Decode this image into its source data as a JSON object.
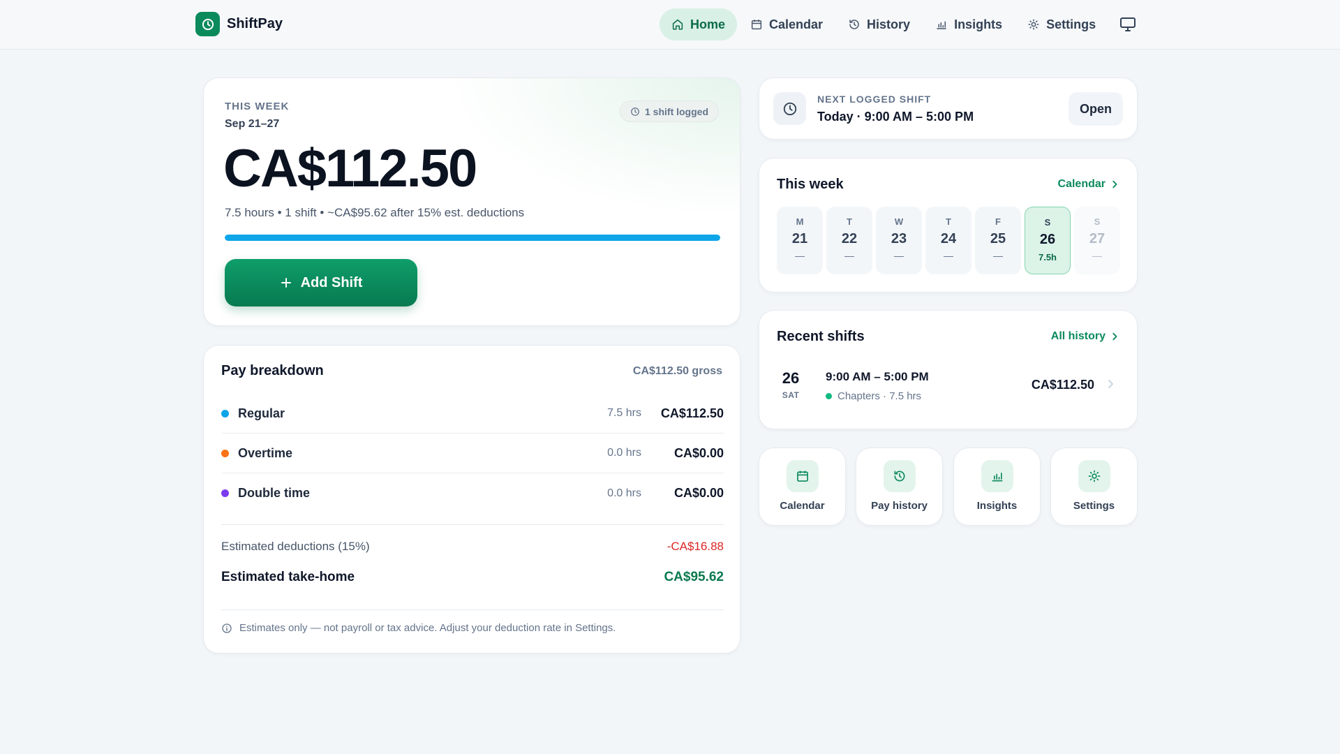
{
  "app": {
    "name": "ShiftPay"
  },
  "nav": {
    "items": [
      {
        "label": "Home",
        "icon": "home-icon",
        "active": true
      },
      {
        "label": "Calendar",
        "icon": "calendar-icon"
      },
      {
        "label": "History",
        "icon": "history-icon"
      },
      {
        "label": "Insights",
        "icon": "bar-chart-icon"
      },
      {
        "label": "Settings",
        "icon": "sun-gear-icon"
      }
    ],
    "display_icon": "monitor-icon"
  },
  "hero": {
    "eyebrow": "THIS WEEK",
    "range": "Sep 21–27",
    "badge": "1 shift logged",
    "amount": "CA$112.50",
    "subtitle": "7.5 hours • 1 shift • ~CA$95.62 after 15% est. deductions",
    "progress_percent": 100,
    "progress_color": "#0ea5e9",
    "add_button": "Add Shift"
  },
  "breakdown": {
    "title": "Pay breakdown",
    "gross": "CA$112.50 gross",
    "rows": [
      {
        "label": "Regular",
        "hours": "7.5 hrs",
        "amount": "CA$112.50",
        "color": "#0ea5e9"
      },
      {
        "label": "Overtime",
        "hours": "0.0 hrs",
        "amount": "CA$0.00",
        "color": "#f97316"
      },
      {
        "label": "Double time",
        "hours": "0.0 hrs",
        "amount": "CA$0.00",
        "color": "#7c3aed"
      }
    ],
    "deductions_label": "Estimated deductions (15%)",
    "deductions_value": "-CA$16.88",
    "takehome_label": "Estimated take-home",
    "takehome_value": "CA$95.62",
    "note": "Estimates only — not payroll or tax advice. Adjust your deduction rate in Settings."
  },
  "next_shift": {
    "eyebrow": "NEXT LOGGED SHIFT",
    "time": "Today · 9:00 AM – 5:00 PM",
    "open_label": "Open"
  },
  "week": {
    "title": "This week",
    "link": "Calendar",
    "days": [
      {
        "letter": "M",
        "num": "21",
        "hours": "—",
        "state": "past"
      },
      {
        "letter": "T",
        "num": "22",
        "hours": "—",
        "state": "past"
      },
      {
        "letter": "W",
        "num": "23",
        "hours": "—",
        "state": "past"
      },
      {
        "letter": "T",
        "num": "24",
        "hours": "—",
        "state": "past"
      },
      {
        "letter": "F",
        "num": "25",
        "hours": "—",
        "state": "past"
      },
      {
        "letter": "S",
        "num": "26",
        "hours": "7.5h",
        "state": "today"
      },
      {
        "letter": "S",
        "num": "27",
        "hours": "—",
        "state": "future"
      }
    ]
  },
  "recent": {
    "title": "Recent shifts",
    "link": "All history",
    "shifts": [
      {
        "day": "26",
        "dow": "SAT",
        "time": "9:00 AM – 5:00 PM",
        "meta": "Chapters · 7.5 hrs",
        "amount": "CA$112.50"
      }
    ]
  },
  "quick_links": [
    {
      "label": "Calendar",
      "icon": "calendar-icon"
    },
    {
      "label": "Pay history",
      "icon": "history-icon"
    },
    {
      "label": "Insights",
      "icon": "bar-chart-icon"
    },
    {
      "label": "Settings",
      "icon": "sun-gear-icon"
    }
  ],
  "colors": {
    "brand": "#0b8a5c",
    "accent_blue": "#0ea5e9",
    "negative": "#dc2626"
  }
}
